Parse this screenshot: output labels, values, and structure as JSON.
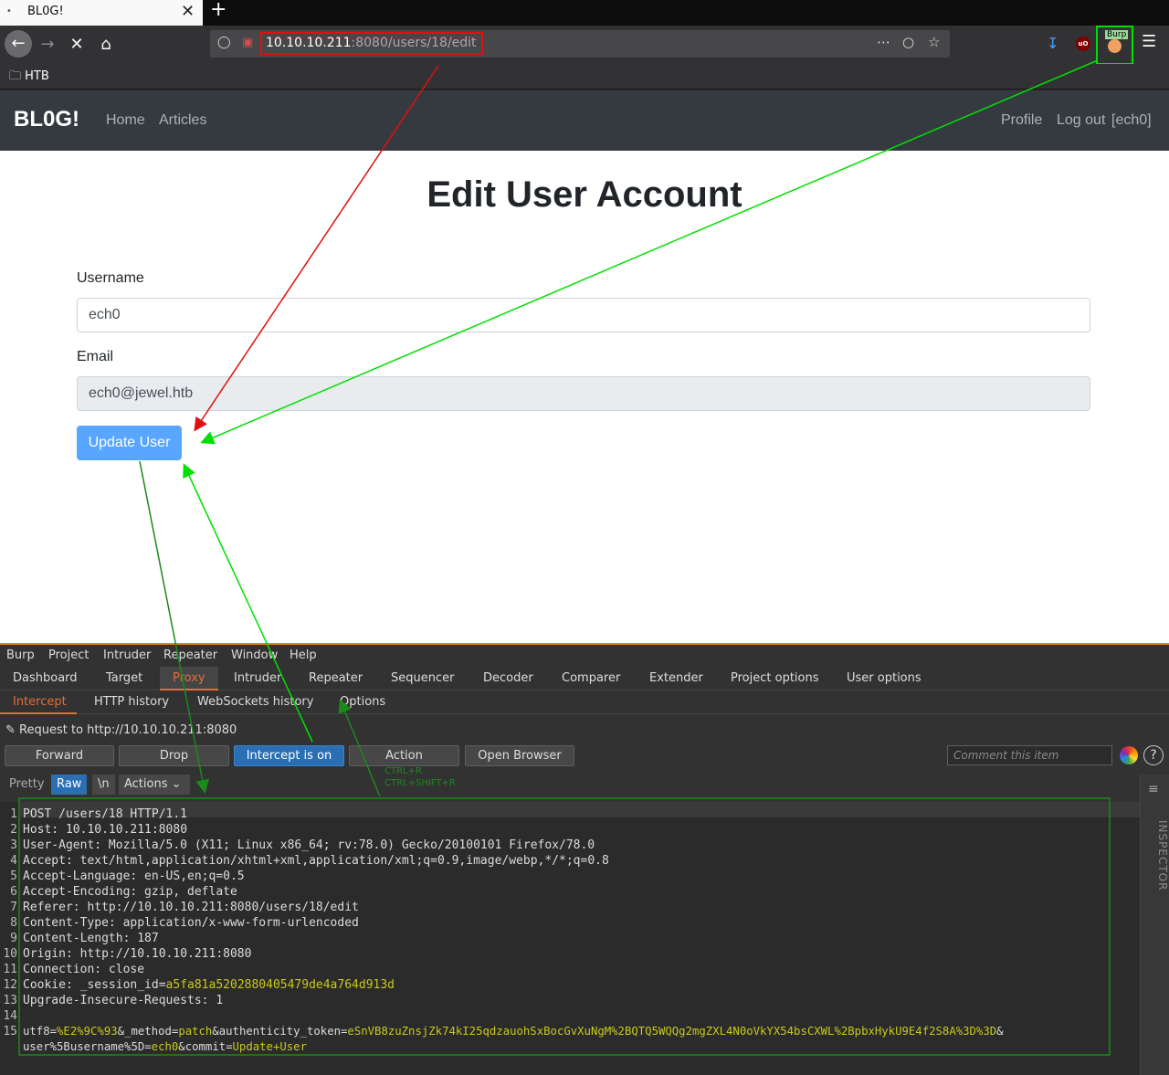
{
  "browser": {
    "tab_title": "BL0G!",
    "tab_dot": "•",
    "tab_close": "✕",
    "new_tab": "+",
    "url_host": "10.10.10.211",
    "url_rest": ":8080/users/18/edit",
    "bookmark": "HTB",
    "burp_badge": "Burp",
    "annotation_color_red": "#e01010",
    "annotation_color_green": "#00e000"
  },
  "site": {
    "brand": "BL0G!",
    "nav_home": "Home",
    "nav_articles": "Articles",
    "nav_profile": "Profile",
    "nav_logout": "Log out",
    "nav_user": "[ech0]",
    "heading": "Edit User Account",
    "username_label": "Username",
    "username_value": "ech0",
    "email_label": "Email",
    "email_value": "ech0@jewel.htb",
    "submit": "Update User",
    "accent": "#58a6ff",
    "navbar_bg": "#343a40"
  },
  "burp": {
    "menu": [
      "Burp",
      "Project",
      "Intruder",
      "Repeater",
      "Window",
      "Help"
    ],
    "tabs": [
      "Dashboard",
      "Target",
      "Proxy",
      "Intruder",
      "Repeater",
      "Sequencer",
      "Decoder",
      "Comparer",
      "Extender",
      "Project options",
      "User options"
    ],
    "subtabs": [
      "Intercept",
      "HTTP history",
      "WebSockets history",
      "Options"
    ],
    "request_to": "Request to http://10.10.10.211:8080",
    "buttons": {
      "forward": "Forward",
      "drop": "Drop",
      "intercept": "Intercept is on",
      "action": "Action",
      "open_browser": "Open Browser"
    },
    "comment_placeholder": "Comment this item",
    "help": "?",
    "editor": {
      "pretty": "Pretty",
      "raw": "Raw",
      "newline": "\\n",
      "actions": "Actions"
    },
    "shortcut_1": "CTRL+R",
    "shortcut_2": "CTRL+SHIFT+R",
    "inspector": "INSPECTOR",
    "accent": "#e0703a",
    "request_lines": [
      {
        "n": "1",
        "key": "POST /users/18 HTTP/1.1",
        "val": ""
      },
      {
        "n": "2",
        "key": "Host:",
        "val": " 10.10.10.211:8080"
      },
      {
        "n": "3",
        "key": "User-Agent:",
        "val": " Mozilla/5.0 (X11; Linux x86_64; rv:78.0) Gecko/20100101 Firefox/78.0"
      },
      {
        "n": "4",
        "key": "Accept:",
        "val": " text/html,application/xhtml+xml,application/xml;q=0.9,image/webp,*/*;q=0.8"
      },
      {
        "n": "5",
        "key": "Accept-Language:",
        "val": " en-US,en;q=0.5"
      },
      {
        "n": "6",
        "key": "Accept-Encoding:",
        "val": " gzip, deflate"
      },
      {
        "n": "7",
        "key": "Referer:",
        "val": " http://10.10.10.211:8080/users/18/edit"
      },
      {
        "n": "8",
        "key": "Content-Type:",
        "val": " application/x-www-form-urlencoded"
      },
      {
        "n": "9",
        "key": "Content-Length:",
        "val": " 187"
      },
      {
        "n": "10",
        "key": "Origin:",
        "val": " http://10.10.10.211:8080"
      },
      {
        "n": "11",
        "key": "Connection:",
        "val": " close"
      },
      {
        "n": "12",
        "key": "Cookie: _session_id=",
        "val": "a5fa81a5202880405479de4a764d913d"
      },
      {
        "n": "13",
        "key": "Upgrade-Insecure-Requests:",
        "val": " 1"
      },
      {
        "n": "14",
        "key": "",
        "val": ""
      },
      {
        "n": "15",
        "key": "",
        "val": ""
      }
    ],
    "body_line_1": [
      {
        "t": "utf8=",
        "c": "k"
      },
      {
        "t": "%E2%9C%93",
        "c": "v"
      },
      {
        "t": "&_method=",
        "c": "k"
      },
      {
        "t": "patch",
        "c": "v"
      },
      {
        "t": "&authenticity_token=",
        "c": "k"
      },
      {
        "t": "eSnVB8zuZnsjZk74kI25qdzauohSxBocGvXuNgM%2BQTQ5WQQg2mgZXL4N0oVkYX54bsCXWL%2BpbxHykU9E4f2S8A%3D%3D",
        "c": "v"
      },
      {
        "t": "&",
        "c": "k"
      }
    ],
    "body_line_2": [
      {
        "t": "user%5Busername%5D=",
        "c": "k"
      },
      {
        "t": "ech0",
        "c": "v"
      },
      {
        "t": "&commit=",
        "c": "k"
      },
      {
        "t": "Update+User",
        "c": "v"
      }
    ]
  }
}
